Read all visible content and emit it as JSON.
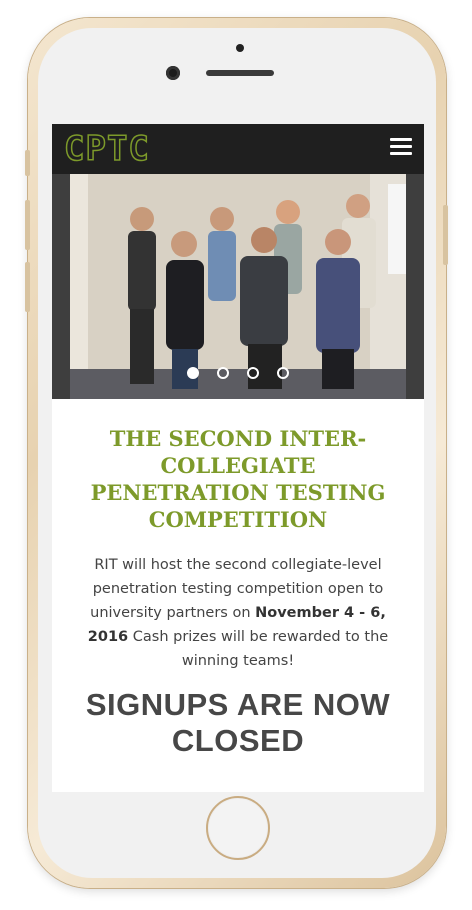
{
  "header": {
    "logo_text": "CPTC",
    "menu_icon": "hamburger-menu-icon"
  },
  "carousel": {
    "active_index": 0,
    "slides_count": 4
  },
  "hero": {
    "title": "THE SECOND INTER-COLLEGIATE PENETRATION TESTING COMPETITION",
    "desc_part1": "RIT will host the second collegiate-level penetration testing competition open to university partners on ",
    "desc_date": "November 4 - 6, 2016",
    "desc_part2": " Cash prizes will be rewarded to the winning teams!",
    "signup_status": "SIGNUPS ARE NOW CLOSED"
  },
  "colors": {
    "accent": "#7d9a2a",
    "navbar": "#1f1f1f",
    "text": "#444444"
  }
}
